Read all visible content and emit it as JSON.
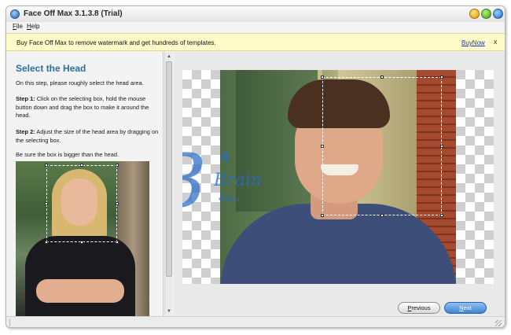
{
  "window": {
    "title": "Face Off Max  3.1.3.8  (Trial)",
    "icon": "app-logo-icon",
    "controls": [
      "minimize-icon",
      "maximize-icon",
      "close-icon"
    ]
  },
  "menu": {
    "file": "File",
    "help": "Help"
  },
  "banner": {
    "text": "Buy Face Off Max to remove watermark and get hundreds of templates.",
    "link": "BuyNow",
    "close": "x"
  },
  "instructions": {
    "title": "Select the Head",
    "intro": "On this step, please roughly select the head area.",
    "step1_label": "Step 1:",
    "step1_text": " Click on the selecting box, hold the mouse button down and drag the box to make it around the head.",
    "step2_label": "Step 2:",
    "step2_text": " Adjust the size of the head area by dragging on the selecting box.",
    "note": "Be sure the box is bigger than the head."
  },
  "watermark": {
    "letter": "B",
    "digit": "4",
    "word": "Brain",
    "sub": "4You"
  },
  "buttons": {
    "previous": "Previous",
    "next": "Next"
  },
  "colors": {
    "title_blue": "#2d6ea3",
    "banner_bg": "#fffbc9",
    "link_blue": "#1a36c8",
    "next_button": "#3f84d6"
  }
}
